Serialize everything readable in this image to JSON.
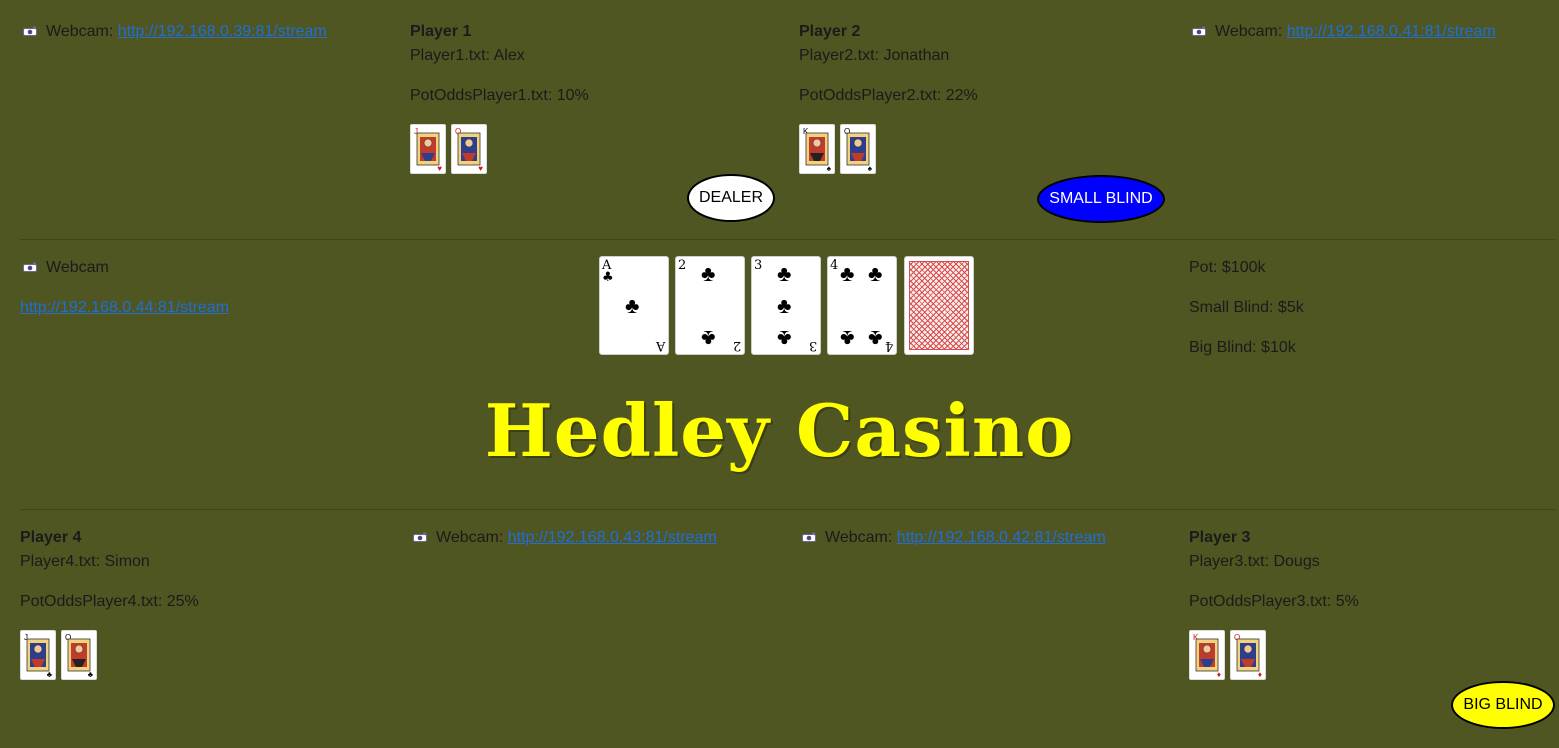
{
  "webcam_label": "Webcam",
  "webcam_label_colon": "Webcam:",
  "top_left_cam": {
    "url": "http://192.168.0.39:81/stream"
  },
  "top_right_cam": {
    "url": "http://192.168.0.41:81/stream"
  },
  "mid_left_cam": {
    "url": "http://192.168.0.44:81/stream"
  },
  "bottom_mid1_cam": {
    "url": "http://192.168.0.43:81/stream"
  },
  "bottom_mid2_cam": {
    "url": "http://192.168.0.42:81/stream"
  },
  "player1": {
    "title": "Player 1",
    "name_line": "Player1.txt: Alex",
    "odds_line": "PotOddsPlayer1.txt: 10%",
    "cards": [
      "J-hearts",
      "Q-hearts"
    ]
  },
  "player2": {
    "title": "Player 2",
    "name_line": "Player2.txt: Jonathan",
    "odds_line": "PotOddsPlayer2.txt: 22%",
    "cards": [
      "K-spades",
      "Q-spades"
    ]
  },
  "player3": {
    "title": "Player 3",
    "name_line": "Player3.txt: Dougs",
    "odds_line": "PotOddsPlayer3.txt: 5%",
    "cards": [
      "K-diamonds",
      "Q-diamonds"
    ]
  },
  "player4": {
    "title": "Player 4",
    "name_line": "Player4.txt: Simon",
    "odds_line": "PotOddsPlayer4.txt: 25%",
    "cards": [
      "J-clubs",
      "Q-clubs"
    ]
  },
  "board": {
    "cards": [
      {
        "rank": "A",
        "suit": "clubs"
      },
      {
        "rank": "2",
        "suit": "clubs"
      },
      {
        "rank": "3",
        "suit": "clubs"
      },
      {
        "rank": "4",
        "suit": "clubs"
      },
      {
        "rank": "",
        "suit": "back"
      }
    ]
  },
  "pot": {
    "pot_line": "Pot: $100k",
    "small_blind_line": "Small Blind: $5k",
    "big_blind_line": "Big Blind: $10k"
  },
  "chips": {
    "dealer": "DEALER",
    "small_blind": "SMALL BLIND",
    "big_blind": "BIG BLIND"
  },
  "title": "Hedley Casino",
  "colors": {
    "background": "#4f5621",
    "link": "#1f6fd6",
    "title": "#ffff00",
    "small_blind_chip": "#0000ff",
    "big_blind_chip": "#ffff00",
    "dealer_chip": "#ffffff",
    "red_suit": "#d01818"
  },
  "icons": {
    "webcam": "webcam-icon"
  }
}
